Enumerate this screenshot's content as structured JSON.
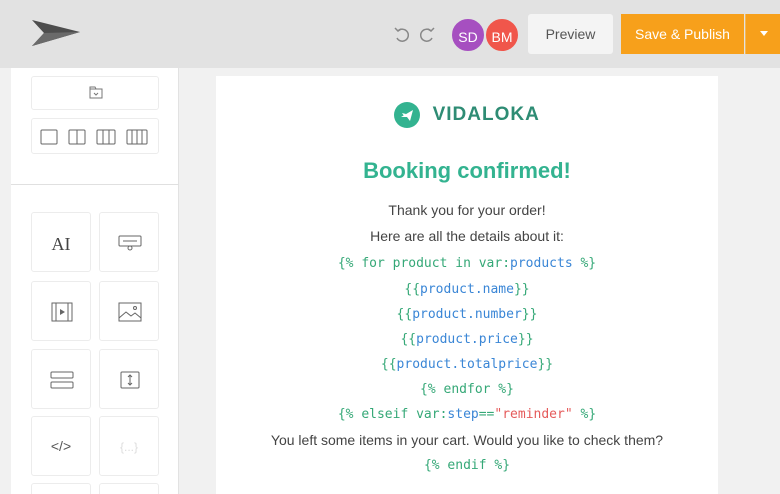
{
  "toolbar": {
    "avatars": [
      {
        "initials": "SD",
        "color": "#a64fc0"
      },
      {
        "initials": "BM",
        "color": "#f0564b"
      }
    ],
    "preview_label": "Preview",
    "publish_label": "Save & Publish",
    "accent": "#f7a01b"
  },
  "sidebar": {
    "blocks": [
      {
        "icon": "text-block-icon",
        "label": "AI"
      },
      {
        "icon": "button-block-icon"
      },
      {
        "icon": "video-block-icon"
      },
      {
        "icon": "image-block-icon"
      },
      {
        "icon": "divider-block-icon"
      },
      {
        "icon": "spacer-block-icon"
      },
      {
        "icon": "html-block-icon",
        "label": "</>"
      },
      {
        "icon": "custom-block-icon",
        "label": "{...}"
      }
    ]
  },
  "email": {
    "brand": "VIDALOKA",
    "headline": "Booking confirmed!",
    "thank_you": "Thank you for your order!",
    "details_intro": "Here are all the details about it:",
    "for_open_a": "{% for product in var:",
    "for_open_b": "products",
    "for_open_c": " %}",
    "name_a": "{{",
    "name_b": "product.name",
    "name_c": "}}",
    "number_a": "{{",
    "number_b": "product.number",
    "number_c": "}}",
    "price_a": "{{",
    "price_b": "product.price",
    "price_c": "}}",
    "total_a": "{{",
    "total_b": "product.totalprice",
    "total_c": "}}",
    "endfor": "{% endfor %}",
    "elseif_a": "{% elseif var:",
    "elseif_b": "step",
    "elseif_c": "==",
    "elseif_d": "\"reminder\"",
    "elseif_e": " %}",
    "reminder_text": "You left some items in your cart. Would you like to check them?",
    "endif": "{% endif %}",
    "colors": {
      "heading": "#33b390",
      "brand": "#2e8c74",
      "tag": "#35a877",
      "var": "#3a86d6",
      "string": "#e55b5b"
    }
  }
}
